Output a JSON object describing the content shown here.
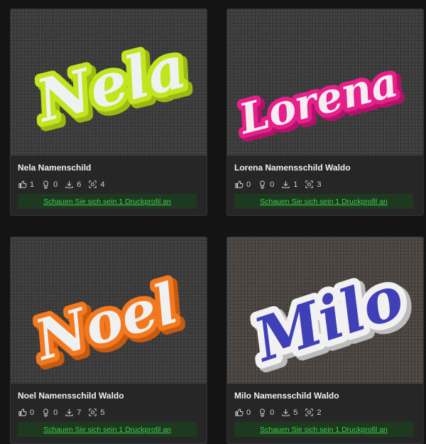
{
  "cards": [
    {
      "title": "Nela Namenschild",
      "likes": "1",
      "prints": "0",
      "downloads": "6",
      "makes": "4",
      "profile_link": "Schauen Sie sich sein 1 Druckprofil an",
      "image_text": "Nela",
      "colors": {
        "outer": "#c3e51d",
        "inner": "#eef2f2"
      }
    },
    {
      "title": "Lorena Namensschild Waldo",
      "likes": "0",
      "prints": "0",
      "downloads": "1",
      "makes": "3",
      "profile_link": "Schauen Sie sich sein 1 Druckprofil an",
      "image_text": "Lorena",
      "colors": {
        "outer": "#e81f8b",
        "inner": "#f4eef2"
      }
    },
    {
      "title": "Noel Namensschild Waldo",
      "likes": "0",
      "prints": "0",
      "downloads": "7",
      "makes": "5",
      "profile_link": "Schauen Sie sich sein 1 Druckprofil an",
      "image_text": "Noel",
      "colors": {
        "outer": "#f4781e",
        "inner": "#eef0f2"
      }
    },
    {
      "title": "Milo Namensschild Waldo",
      "likes": "0",
      "prints": "0",
      "downloads": "5",
      "makes": "2",
      "profile_link": "Schauen Sie sich sein 1 Druckprofil an",
      "image_text": "Milo",
      "colors": {
        "outer": "#f1f1f1",
        "inner": "#3f3fb8"
      }
    }
  ]
}
